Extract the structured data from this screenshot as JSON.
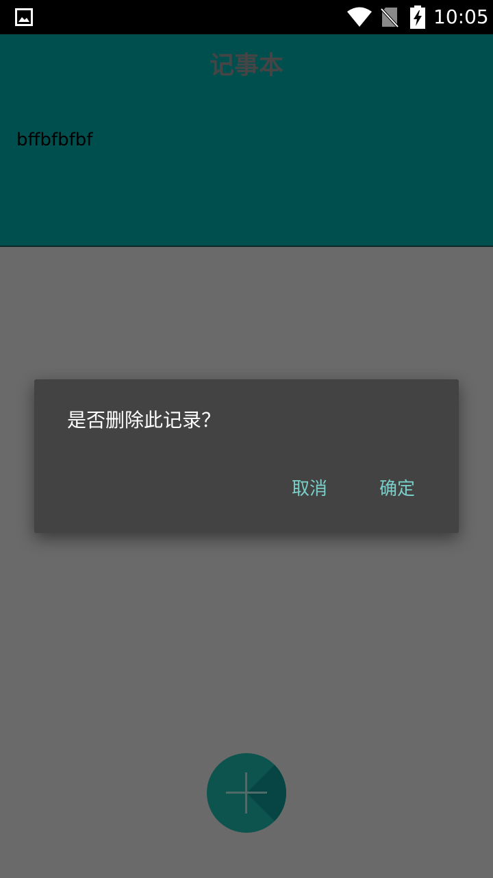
{
  "status_bar": {
    "time": "10:05",
    "icons": [
      "gallery-icon",
      "wifi-icon",
      "no-sim-icon",
      "battery-charging-icon"
    ]
  },
  "app": {
    "title": "记事本",
    "notes": [
      {
        "text": "bffbfbfbf"
      }
    ],
    "fab_icon": "plus-icon"
  },
  "dialog": {
    "message": "是否删除此记录？",
    "cancel_label": "取消",
    "confirm_label": "确定"
  },
  "colors": {
    "header": "#009e9e",
    "body": "#d4d4d4",
    "dialog_bg": "#434343",
    "dialog_button": "#79cfc8",
    "fab": "#1aa89c"
  }
}
